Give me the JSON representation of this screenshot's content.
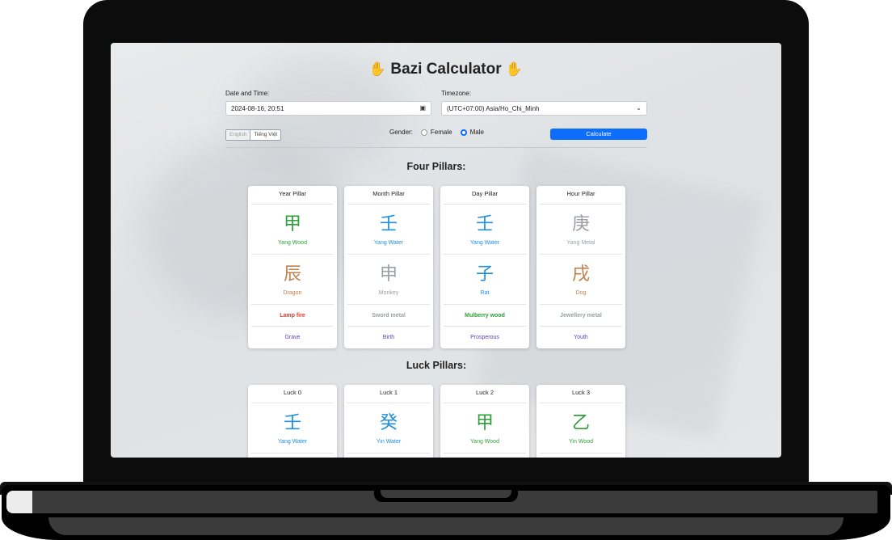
{
  "app": {
    "title": "Bazi Calculator",
    "title_icon": "hamsa-icon"
  },
  "form": {
    "datetime_label": "Date and Time:",
    "datetime_value": "2024-08-16, 20:51",
    "timezone_label": "Timezone:",
    "timezone_value": "(UTC+07:00) Asia/Ho_Chi_Minh",
    "languages": [
      "English",
      "Tiếng Việt"
    ],
    "gender_label": "Gender:",
    "gender_options": [
      "Female",
      "Male"
    ],
    "gender_selected": "Male",
    "calculate_label": "Calculate"
  },
  "four_pillars": {
    "title": "Four Pillars:",
    "pillars": [
      {
        "header": "Year Pillar",
        "stem_char": "甲",
        "stem_name": "Yang Wood",
        "branch_char": "辰",
        "branch_name": "Dragon",
        "nayin": "Lamp fire",
        "stage": "Grave"
      },
      {
        "header": "Month Pillar",
        "stem_char": "壬",
        "stem_name": "Yang Water",
        "branch_char": "申",
        "branch_name": "Monkey",
        "nayin": "Sword metal",
        "stage": "Birth"
      },
      {
        "header": "Day Pillar",
        "stem_char": "壬",
        "stem_name": "Yang Water",
        "branch_char": "子",
        "branch_name": "Rat",
        "nayin": "Mulberry wood",
        "stage": "Prosperous"
      },
      {
        "header": "Hour Pillar",
        "stem_char": "庚",
        "stem_name": "Yang Metal",
        "branch_char": "戌",
        "branch_name": "Dog",
        "nayin": "Jewellery metal",
        "stage": "Youth"
      }
    ]
  },
  "luck_pillars": {
    "title": "Luck Pillars:",
    "pillars": [
      {
        "header": "Luck 0",
        "stem_char": "壬",
        "stem_name": "Yang Water"
      },
      {
        "header": "Luck 1",
        "stem_char": "癸",
        "stem_name": "Yin Water"
      },
      {
        "header": "Luck 2",
        "stem_char": "甲",
        "stem_name": "Yang Wood"
      },
      {
        "header": "Luck 3",
        "stem_char": "乙",
        "stem_name": "Yin Wood"
      }
    ]
  },
  "colors": {
    "wood": "#2e9e3a",
    "water": "#1f8fe0",
    "metal": "#9aa0a6",
    "earth": "#c0834f",
    "fire": "#e23b2e",
    "stage": "#5b3fc4",
    "accent": "#0d6efd"
  }
}
